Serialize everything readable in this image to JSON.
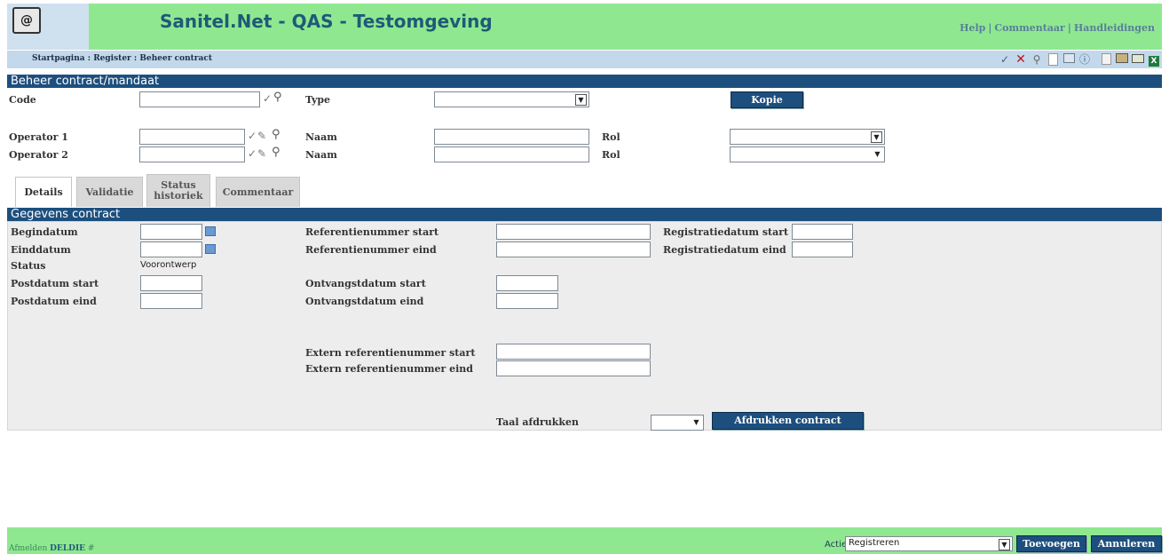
{
  "header": {
    "logo_text": "@",
    "title": "Sanitel.Net - QAS - Testomgeving",
    "links": [
      "Help",
      "Commentaar",
      "Handleidingen"
    ]
  },
  "breadcrumb": "Startpagina : Register : Beheer contract",
  "toolbar": {
    "icons": [
      "check-icon",
      "cancel-icon",
      "search-icon",
      "new-document-icon",
      "window-icon",
      "info-icon",
      "copy-icon",
      "print-icon",
      "mail-icon",
      "excel-icon"
    ]
  },
  "contract_section": {
    "title": "Beheer contract/mandaat",
    "code_label": "Code",
    "code_value": "",
    "type_label": "Type",
    "type_value": "",
    "kopie_label": "Kopie",
    "operator1_label": "Operator 1",
    "operator2_label": "Operator 2",
    "naam_label": "Naam",
    "rol_label": "Rol"
  },
  "tabs": [
    {
      "label": "Details",
      "active": true
    },
    {
      "label": "Validatie",
      "active": false
    },
    {
      "label": "Status historiek",
      "active": false
    },
    {
      "label": "Commentaar",
      "active": false
    }
  ],
  "details": {
    "title": "Gegevens contract",
    "begindatum": "Begindatum",
    "einddatum": "Einddatum",
    "status_label": "Status",
    "status_value": "Voorontwerp",
    "postdatum_start": "Postdatum start",
    "postdatum_eind": "Postdatum eind",
    "ref_start": "Referentienummer start",
    "ref_eind": "Referentienummer eind",
    "ontvang_start": "Ontvangstdatum start",
    "ontvang_eind": "Ontvangstdatum eind",
    "ext_ref_start": "Extern referentienummer start",
    "ext_ref_eind": "Extern referentienummer eind",
    "reg_start": "Registratiedatum start",
    "reg_eind": "Registratiedatum eind",
    "taal_label": "Taal afdrukken",
    "afdrukken_label": "Afdrukken contract"
  },
  "footer": {
    "afmelden": "Afmelden",
    "user": "DELDIE",
    "hash": "#",
    "actie_label": "Actie :",
    "actie_value": "Registreren",
    "toevoegen": "Toevoegen",
    "annuleren": "Annuleren"
  }
}
